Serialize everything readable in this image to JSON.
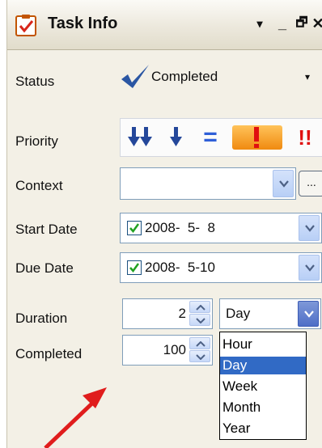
{
  "window": {
    "title": "Task Info",
    "controls": [
      "▾",
      "_",
      "🗗",
      "✕"
    ]
  },
  "status": {
    "label": "Status",
    "value": "Completed",
    "arrow": "▾"
  },
  "priority": {
    "label": "Priority",
    "levels": [
      "lowest",
      "low",
      "normal",
      "high",
      "highest"
    ],
    "normal_glyph": "=",
    "highest_glyph": "!!"
  },
  "context": {
    "label": "Context",
    "value": "",
    "browse_label": "..."
  },
  "start_date": {
    "label": "Start Date",
    "checked": true,
    "value": "2008-  5-  8"
  },
  "due_date": {
    "label": "Due Date",
    "checked": true,
    "value": "2008-  5-10"
  },
  "duration": {
    "label": "Duration",
    "value": "2",
    "unit": "Day",
    "unit_options": [
      "Hour",
      "Day",
      "Week",
      "Month",
      "Year"
    ],
    "selected_unit": "Day"
  },
  "completed": {
    "label": "Completed",
    "value": "100"
  },
  "colors": {
    "accent": "#2f5fa8",
    "selection": "#316ac5",
    "priority_high": "#f5a623",
    "priority_highest": "#e01010",
    "arrow": "#e01d1d"
  }
}
